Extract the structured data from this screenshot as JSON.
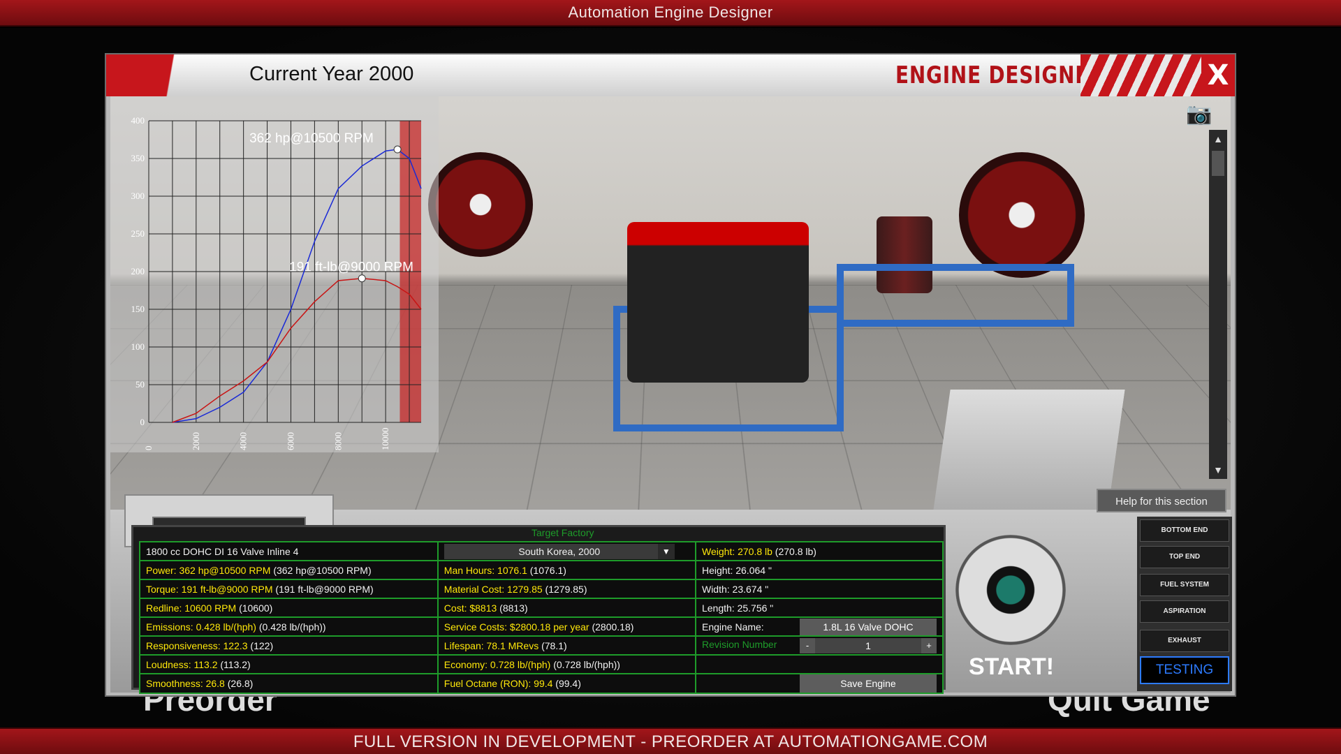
{
  "app": {
    "title": "Automation Engine Designer",
    "footer": "FULL VERSION IN DEVELOPMENT - PREORDER AT AUTOMATIONGAME.COM"
  },
  "background": {
    "left_text": "Preorder",
    "right_text": "Quit Game"
  },
  "header": {
    "current_year": "Current Year 2000",
    "title": "ENGINE DESIGNER",
    "close_label": "X"
  },
  "viewport": {
    "camera_icon": "camera-icon",
    "scroll_up": "▲",
    "scroll_down": "▼"
  },
  "chart_data": {
    "type": "line",
    "title": "",
    "xlabel": "",
    "ylabel": "",
    "xlim": [
      0,
      11500
    ],
    "ylim": [
      0,
      400
    ],
    "x_ticks": [
      0,
      2000,
      4000,
      6000,
      8000,
      10000
    ],
    "y_ticks": [
      0,
      50,
      100,
      150,
      200,
      250,
      300,
      350,
      400
    ],
    "redline_from": 10600,
    "series": [
      {
        "color": "#1a2ad6",
        "x": [
          1000,
          2000,
          3000,
          4000,
          5000,
          6000,
          7000,
          8000,
          9000,
          10000,
          10500,
          11000,
          11500
        ],
        "values": [
          0,
          5,
          20,
          40,
          80,
          150,
          240,
          310,
          340,
          360,
          362,
          350,
          310
        ]
      },
      {
        "color": "#c81414",
        "x": [
          1000,
          2000,
          3000,
          4000,
          5000,
          6000,
          7000,
          8000,
          9000,
          10000,
          10500,
          11000,
          11500
        ],
        "values": [
          0,
          12,
          35,
          55,
          80,
          125,
          160,
          188,
          191,
          188,
          180,
          170,
          150
        ]
      }
    ],
    "annotations": [
      {
        "text": "362 hp@10500 RPM",
        "x": 10500,
        "y": 362
      },
      {
        "text": "191 ft-lb@9000 RPM",
        "x": 9000,
        "y": 191
      }
    ]
  },
  "stats": {
    "target_factory_label": "Target Factory",
    "factory_value": "South Korea, 2000",
    "rows": [
      [
        "1800 cc DOHC DI 16 Valve Inline 4",
        "",
        "Weight: 270.8 lb",
        " (270.8 lb)"
      ],
      [
        "Power: 362 hp@10500 RPM",
        " (362 hp@10500 RPM)",
        "Man Hours: 1076.1",
        " (1076.1)",
        "Height: 26.064 \""
      ],
      [
        "Torque: 191 ft-lb@9000 RPM",
        " (191 ft-lb@9000 RPM)",
        "Material Cost: 1279.85",
        " (1279.85)",
        "Width: 23.674 \""
      ],
      [
        "Redline: 10600 RPM",
        " (10600)",
        "Cost: $8813",
        " (8813)",
        "Length: 25.756 \""
      ],
      [
        "Emissions: 0.428 lb/(hph)",
        " (0.428 lb/(hph))",
        "Service Costs: $2800.18 per year",
        " (2800.18)"
      ],
      [
        "Responsiveness: 122.3",
        " (122)",
        "Lifespan: 78.1 MRevs",
        " (78.1)"
      ],
      [
        "Loudness: 113.2",
        " (113.2)",
        "Economy: 0.728 lb/(hph)",
        " (0.728 lb/(hph))"
      ],
      [
        "Smoothness: 26.8",
        " (26.8)",
        "Fuel Octane (RON): 99.4",
        " (99.4)"
      ]
    ],
    "engine_name_label": "Engine Name:",
    "engine_name_value": "1.8L 16 Valve DOHC",
    "revision_label": "Revision Number",
    "revision_value": "1",
    "rev_minus": "-",
    "rev_plus": "+",
    "save_label": "Save Engine"
  },
  "start": {
    "label": "START!"
  },
  "help": {
    "label": "Help for this section"
  },
  "sections": [
    "BOTTOM END",
    "TOP END",
    "FUEL SYSTEM",
    "ASPIRATION",
    "EXHAUST"
  ],
  "active_section": "TESTING"
}
